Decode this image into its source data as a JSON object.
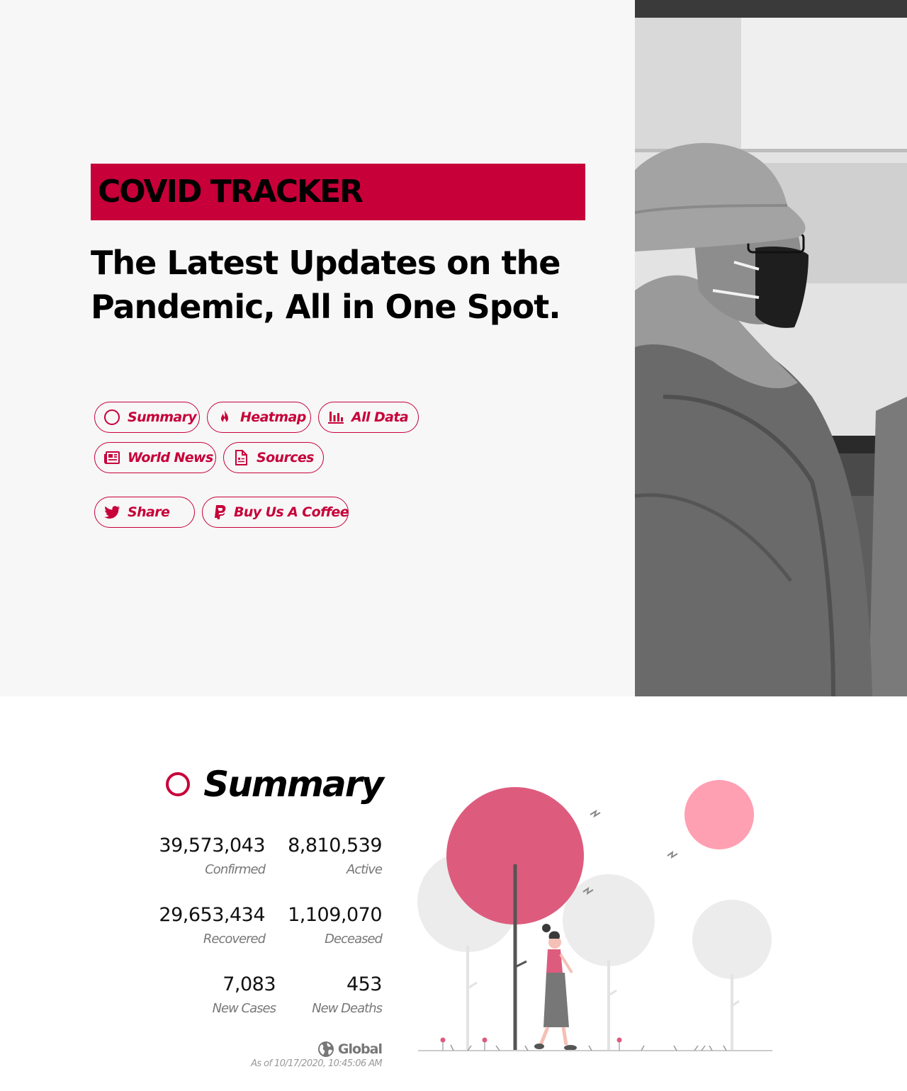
{
  "hero": {
    "brand": "COVID TRACKER",
    "tagline_line1": "The Latest Updates on the",
    "tagline_line2": "Pandemic, All in One Spot.",
    "nav": [
      {
        "label": "Summary",
        "icon": "circle-icon"
      },
      {
        "label": "Heatmap",
        "icon": "fire-icon"
      },
      {
        "label": "All Data",
        "icon": "bar-chart-icon"
      },
      {
        "label": "World News",
        "icon": "newspaper-icon"
      },
      {
        "label": "Sources",
        "icon": "document-icon"
      }
    ],
    "actions": [
      {
        "label": "Share",
        "icon": "twitter-icon"
      },
      {
        "label": "Buy Us A Coffee",
        "icon": "paypal-icon"
      }
    ]
  },
  "summary": {
    "title": "Summary",
    "stats": [
      {
        "value": "39,573,043",
        "label": "Confirmed"
      },
      {
        "value": "8,810,539",
        "label": "Active"
      },
      {
        "value": "29,653,434",
        "label": "Recovered"
      },
      {
        "value": "1,109,070",
        "label": "Deceased"
      },
      {
        "value": "7,083",
        "label": "New Cases"
      },
      {
        "value": "453",
        "label": "New Deaths"
      }
    ],
    "scope": "Global",
    "as_of": "As of 10/17/2020, 10:45:06 AM"
  },
  "colors": {
    "accent": "#c70039",
    "hero_bg": "#f7f7f7",
    "muted_text": "#777777",
    "tree_pink": "#dd5c7e",
    "sun_pink": "#ff9fb2",
    "tree_gray": "#ececec"
  }
}
